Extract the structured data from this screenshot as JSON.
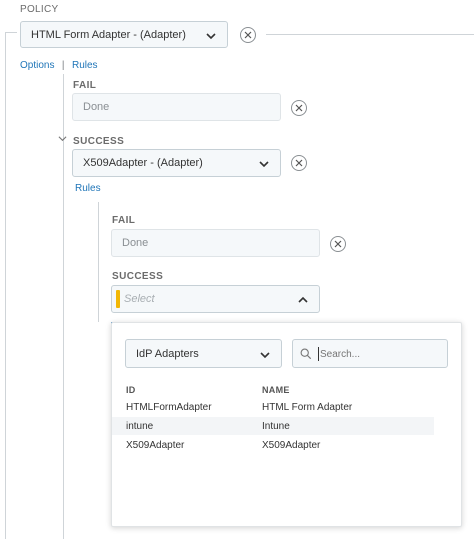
{
  "policy": {
    "label": "POLICY",
    "root_select": {
      "value": "HTML Form Adapter - (Adapter)"
    },
    "links": {
      "options": "Options",
      "separator": "|",
      "rules": "Rules"
    }
  },
  "level1": {
    "fail": {
      "label": "FAIL",
      "value": "Done"
    },
    "success": {
      "label": "SUCCESS",
      "select_value": "X509Adapter - (Adapter)",
      "rules_link": "Rules"
    }
  },
  "level2": {
    "fail": {
      "label": "FAIL",
      "value": "Done"
    },
    "success": {
      "label": "SUCCESS",
      "placeholder": "Select"
    }
  },
  "popup": {
    "type_select": "IdP Adapters",
    "search_placeholder": "Search...",
    "columns": {
      "id": "ID",
      "name": "NAME"
    },
    "rows": [
      {
        "id": "HTMLFormAdapter",
        "name": "HTML Form Adapter"
      },
      {
        "id": "intune",
        "name": "Intune"
      },
      {
        "id": "X509Adapter",
        "name": "X509Adapter"
      }
    ]
  },
  "colors": {
    "link": "#1f75b8",
    "accent_marker": "#f2b705",
    "border": "#c6d0d6"
  },
  "icons": [
    "close-icon",
    "chevron-down-icon",
    "chevron-up-icon",
    "search-icon",
    "collapse-chevron-icon"
  ]
}
